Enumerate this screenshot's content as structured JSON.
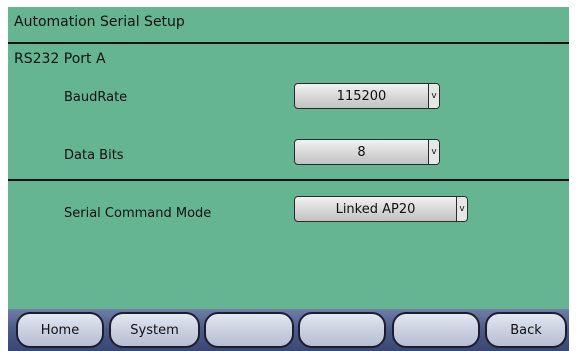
{
  "header": {
    "title": "Automation Serial Setup"
  },
  "section": {
    "title": "RS232 Port A"
  },
  "fields": {
    "baud_rate": {
      "label": "BaudRate",
      "value": "115200",
      "arrow": "v"
    },
    "data_bits": {
      "label": "Data Bits",
      "value": "8",
      "arrow": "v"
    },
    "serial_command_mode": {
      "label": "Serial Command Mode",
      "value": "Linked AP20",
      "arrow": "v"
    }
  },
  "navbar": {
    "buttons": [
      {
        "label": "Home"
      },
      {
        "label": "System"
      },
      {
        "label": ""
      },
      {
        "label": ""
      },
      {
        "label": ""
      },
      {
        "label": "Back"
      }
    ]
  },
  "colors": {
    "background": "#66b592",
    "navbar": "#4a5a86",
    "button": "#c8cfdf"
  }
}
